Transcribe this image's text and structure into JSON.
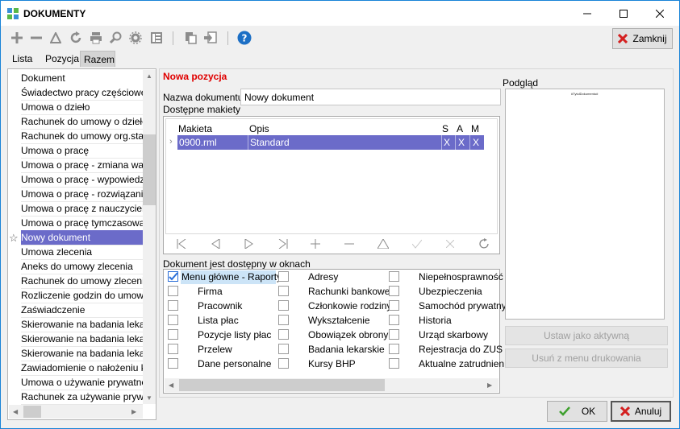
{
  "window": {
    "title": "DOKUMENTY"
  },
  "toolbar": {
    "close_label": "Zamknij"
  },
  "tabs": [
    "Lista",
    "Pozycja",
    "Razem"
  ],
  "left_list": {
    "header": "Dokument",
    "items": [
      "Świadectwo pracy częściowe",
      "Umowa o dzieło",
      "Rachunek do umowy o dzieło",
      "Rachunek do umowy org.stano",
      "Umowa o pracę",
      "Umowa o pracę - zmiana warun",
      "Umowa o pracę - wypowiedzen",
      "Umowa o pracę - rozwiązanie",
      "Umowa o pracę z nauczycielem",
      "Umowa o pracę tymczasową",
      "Nowy dokument",
      "Umowa zlecenia",
      "Aneks do umowy zlecenia",
      "Rachunek do umowy zlecenia",
      "Rozliczenie godzin do umowy zl",
      "Zaświadczenie",
      "Skierowanie na badania lekarsk",
      "Skierowanie na badania lekarsk",
      "Skierowanie na badania lekarsk",
      "Zawiadomienie o nałożeniu kary",
      "Umowa o używanie prywatnego",
      "Rachunek za używanie prywatn"
    ],
    "selected_index": 10
  },
  "form": {
    "section_title": "Nowa pozycja",
    "name_label": "Nazwa dokumentu",
    "name_value": "Nowy dokument",
    "templates_label": "Dostępne makiety",
    "grid_headers": {
      "makieta": "Makieta",
      "opis": "Opis",
      "s": "S",
      "a": "A",
      "m": "M"
    },
    "grid_row": {
      "makieta": "0900.rml",
      "opis": "Standard",
      "s": "X",
      "a": "X",
      "m": "X"
    },
    "windows_label": "Dokument jest dostępny w oknach",
    "windows": {
      "col1": [
        "Menu główne - Raporty",
        "Firma",
        "Pracownik",
        "Lista płac",
        "Pozycje listy płac",
        "Przelew",
        "Dane personalne"
      ],
      "col2": [
        "Adresy",
        "Rachunki bankowe",
        "Członkowie rodziny",
        "Wykształcenie",
        "Obowiązek obrony",
        "Badania lekarskie",
        "Kursy BHP"
      ],
      "col3": [
        "Niepełnosprawność",
        "Ubezpieczenia",
        "Samochód prywatny",
        "Historia",
        "Urząd skarbowy",
        "Rejestracja do ZUS",
        "Aktualne zatrudnien"
      ],
      "checked": [
        "Menu główne - Raporty"
      ]
    }
  },
  "preview": {
    "label": "Podgląd",
    "tiny_text": "#TytulDokumentu#"
  },
  "side_buttons": {
    "set_active": "Ustaw jako aktywną",
    "remove_print": "Usuń z menu drukowania"
  },
  "footer": {
    "ok": "OK",
    "cancel": "Anuluj"
  },
  "colors": {
    "selection": "#6b6bc9",
    "title_red": "#e00000",
    "check_blue": "#2c6fd8"
  }
}
